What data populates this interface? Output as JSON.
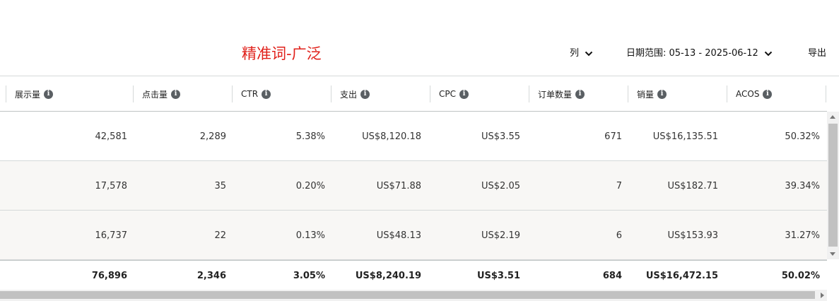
{
  "toolbar": {
    "title": "精准词-广泛",
    "columns_label": "列",
    "date_range_label": "日期范围: 05-13 - 2025-06-12",
    "export_label": "导出"
  },
  "table": {
    "columns": [
      {
        "key": "impressions",
        "label": "展示量"
      },
      {
        "key": "clicks",
        "label": "点击量"
      },
      {
        "key": "ctr",
        "label": "CTR"
      },
      {
        "key": "spend",
        "label": "支出"
      },
      {
        "key": "cpc",
        "label": "CPC"
      },
      {
        "key": "orders",
        "label": "订单数量"
      },
      {
        "key": "sales",
        "label": "销量"
      },
      {
        "key": "acos",
        "label": "ACOS"
      }
    ],
    "rows": [
      [
        "42,581",
        "2,289",
        "5.38%",
        "US$8,120.18",
        "US$3.55",
        "671",
        "US$16,135.51",
        "50.32%"
      ],
      [
        "17,578",
        "35",
        "0.20%",
        "US$71.88",
        "US$2.05",
        "7",
        "US$182.71",
        "39.34%"
      ],
      [
        "16,737",
        "22",
        "0.13%",
        "US$48.13",
        "US$2.19",
        "6",
        "US$153.93",
        "31.27%"
      ]
    ],
    "totals": [
      "76,896",
      "2,346",
      "3.05%",
      "US$8,240.19",
      "US$3.51",
      "684",
      "US$16,472.15",
      "50.02%"
    ]
  },
  "icons": {
    "info": "info-icon",
    "chevron": "chevron-down-icon"
  },
  "colors": {
    "title": "#e0201a",
    "alt_row": "#f8f7f5"
  }
}
